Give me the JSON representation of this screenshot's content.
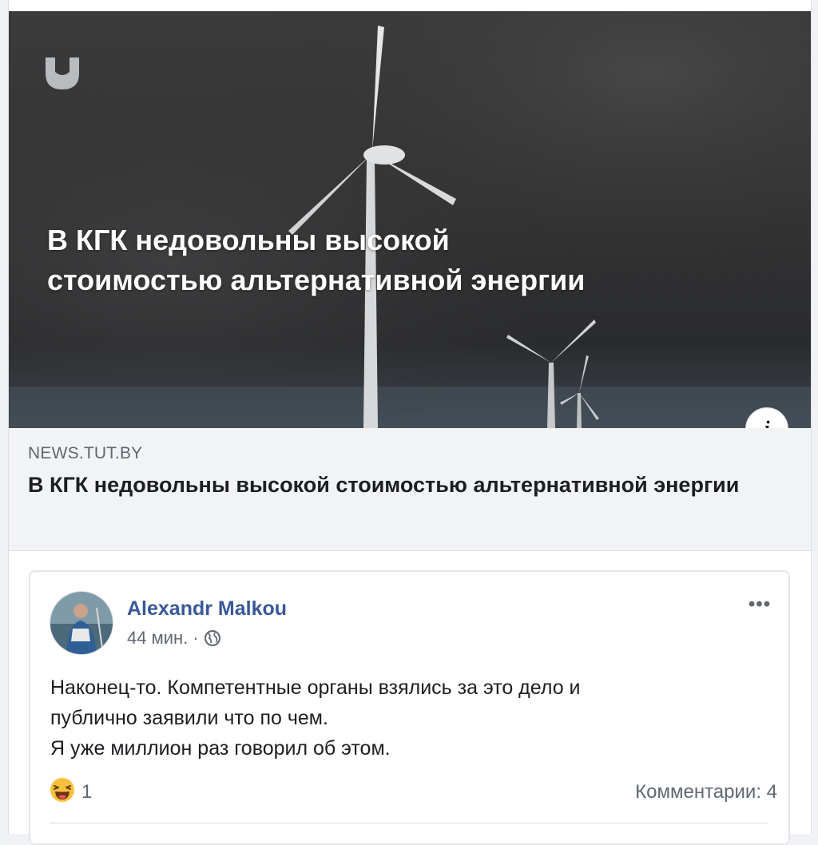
{
  "link_preview": {
    "image_headline": "В КГК недовольны высокой стоимостью альтернативной энергии",
    "image_headline_line1": "В КГК недовольны высокой",
    "image_headline_line2": "стоимостью альтернативной энергии",
    "info_glyph": "i",
    "domain": "NEWS.TUT.BY",
    "title": "В КГК недовольны высокой стоимостью альтернативной энергии"
  },
  "post": {
    "author": "Alexandr Malkou",
    "time": "44 мин.",
    "separator": "·",
    "privacy_icon": "globe-icon",
    "more_label": "•••",
    "text_lines": [
      "Наконец-то. Компетентные органы взялись за это дело и",
      "публично заявили что по чем.",
      "Я уже миллион раз говорил об этом."
    ],
    "reaction_icon": "haha-emoji-icon",
    "reaction_count": "1",
    "comments_label": "Комментарии: 4"
  },
  "colors": {
    "author_link": "#385898",
    "secondary_text": "#606770",
    "primary_text": "#1c1e21",
    "meta_background": "#f2f3f5"
  }
}
